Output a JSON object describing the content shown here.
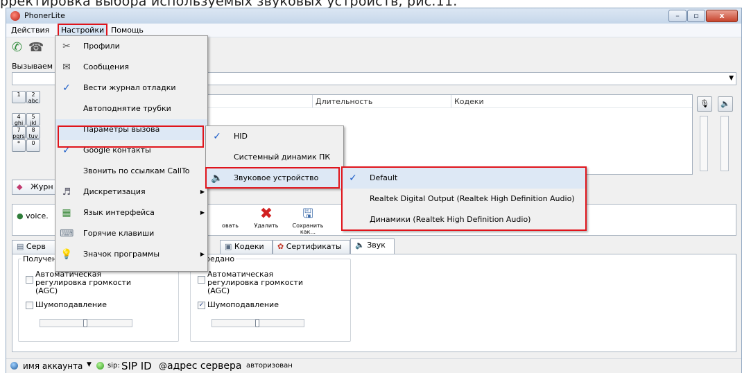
{
  "caption": "рректировка выбора используемых звуковых устройств, рис.11.",
  "window": {
    "title": "PhonerLite",
    "controls": {
      "minimize": "–",
      "maximize": "▫",
      "close": "x"
    }
  },
  "menubar": {
    "items": [
      "Действия",
      "Настройки",
      "Помощь"
    ]
  },
  "called_label": "Вызываем",
  "dialpad": {
    "keys": [
      {
        "main": "1",
        "sub": ""
      },
      {
        "main": "2",
        "sub": "abc"
      },
      {
        "main": "4",
        "sub": "ghi"
      },
      {
        "main": "5",
        "sub": "jkl"
      },
      {
        "main": "7",
        "sub": "pqrs"
      },
      {
        "main": "8",
        "sub": "tuv"
      },
      {
        "main": "*",
        "sub": ""
      },
      {
        "main": "0",
        "sub": ""
      }
    ]
  },
  "call_list": {
    "columns": [
      "Длительность",
      "Кодеки"
    ]
  },
  "journal_tab": "Журн",
  "accounts": {
    "item": "voice.",
    "toolbar": [
      "Редактировать",
      "Удалить",
      "Сохранить как..."
    ],
    "toolbar_visible": [
      "овать",
      "Удалить",
      "Сохранить как..."
    ]
  },
  "tabs": [
    "Серв",
    "Кодеки",
    "Сертификаты",
    "Звук"
  ],
  "sound_panel": {
    "received": {
      "title": "Получен",
      "agc": "Автоматическая регулировка громкости (AGC)",
      "agc_checked": false,
      "noise": "Шумоподавление",
      "noise_checked": false
    },
    "sent": {
      "title": "Передано",
      "agc": "Автоматическая регулировка громкости (AGC)",
      "agc_checked": false,
      "noise": "Шумоподавление",
      "noise_checked": true
    }
  },
  "statusbar": {
    "account": "имя аккаунта",
    "sip_prefix": "sip:",
    "sip_id": "SIP ID",
    "at": "@",
    "server": "адрес сервера",
    "status": "авторизован"
  },
  "settings_menu": {
    "items": [
      {
        "label": "Профили",
        "icon": "tools-icon",
        "checked": false,
        "submenu": false
      },
      {
        "label": "Сообщения",
        "icon": "envelope-icon",
        "checked": false,
        "submenu": false
      },
      {
        "label": "Вести журнал отладки",
        "icon": "",
        "checked": true,
        "submenu": false
      },
      {
        "label": "Автоподнятие трубки",
        "icon": "",
        "checked": false,
        "submenu": false
      },
      {
        "label": "Параметры вызова",
        "icon": "",
        "checked": false,
        "submenu": false
      },
      {
        "label": "Google контакты",
        "icon": "",
        "checked": true,
        "submenu": false
      },
      {
        "label": "Звонить по ссылкам CallTo",
        "icon": "",
        "checked": false,
        "submenu": false
      },
      {
        "label": "Дискретизация",
        "icon": "sampling-icon",
        "checked": false,
        "submenu": true
      },
      {
        "label": "Язык интерфейса",
        "icon": "language-icon",
        "checked": false,
        "submenu": true
      },
      {
        "label": "Горячие клавиши",
        "icon": "keyboard-icon",
        "checked": false,
        "submenu": false
      },
      {
        "label": "Значок программы",
        "icon": "bulb-icon",
        "checked": false,
        "submenu": true
      }
    ]
  },
  "call_params_menu": {
    "items": [
      {
        "label": "HID",
        "checked": true
      },
      {
        "label": "Системный динамик ПК",
        "checked": false
      },
      {
        "label": "Звуковое устройство",
        "checked": false
      }
    ]
  },
  "device_menu": {
    "items": [
      {
        "label": "Default",
        "checked": true
      },
      {
        "label": "Realtek Digital Output (Realtek High Definition Audio)",
        "checked": false
      },
      {
        "label": "Динамики (Realtek High Definition Audio)",
        "checked": false
      }
    ]
  },
  "colors": {
    "highlight_red": "#e0141b",
    "menu_bg": "#f0f0f0",
    "check_blue": "#1d5ec9"
  }
}
